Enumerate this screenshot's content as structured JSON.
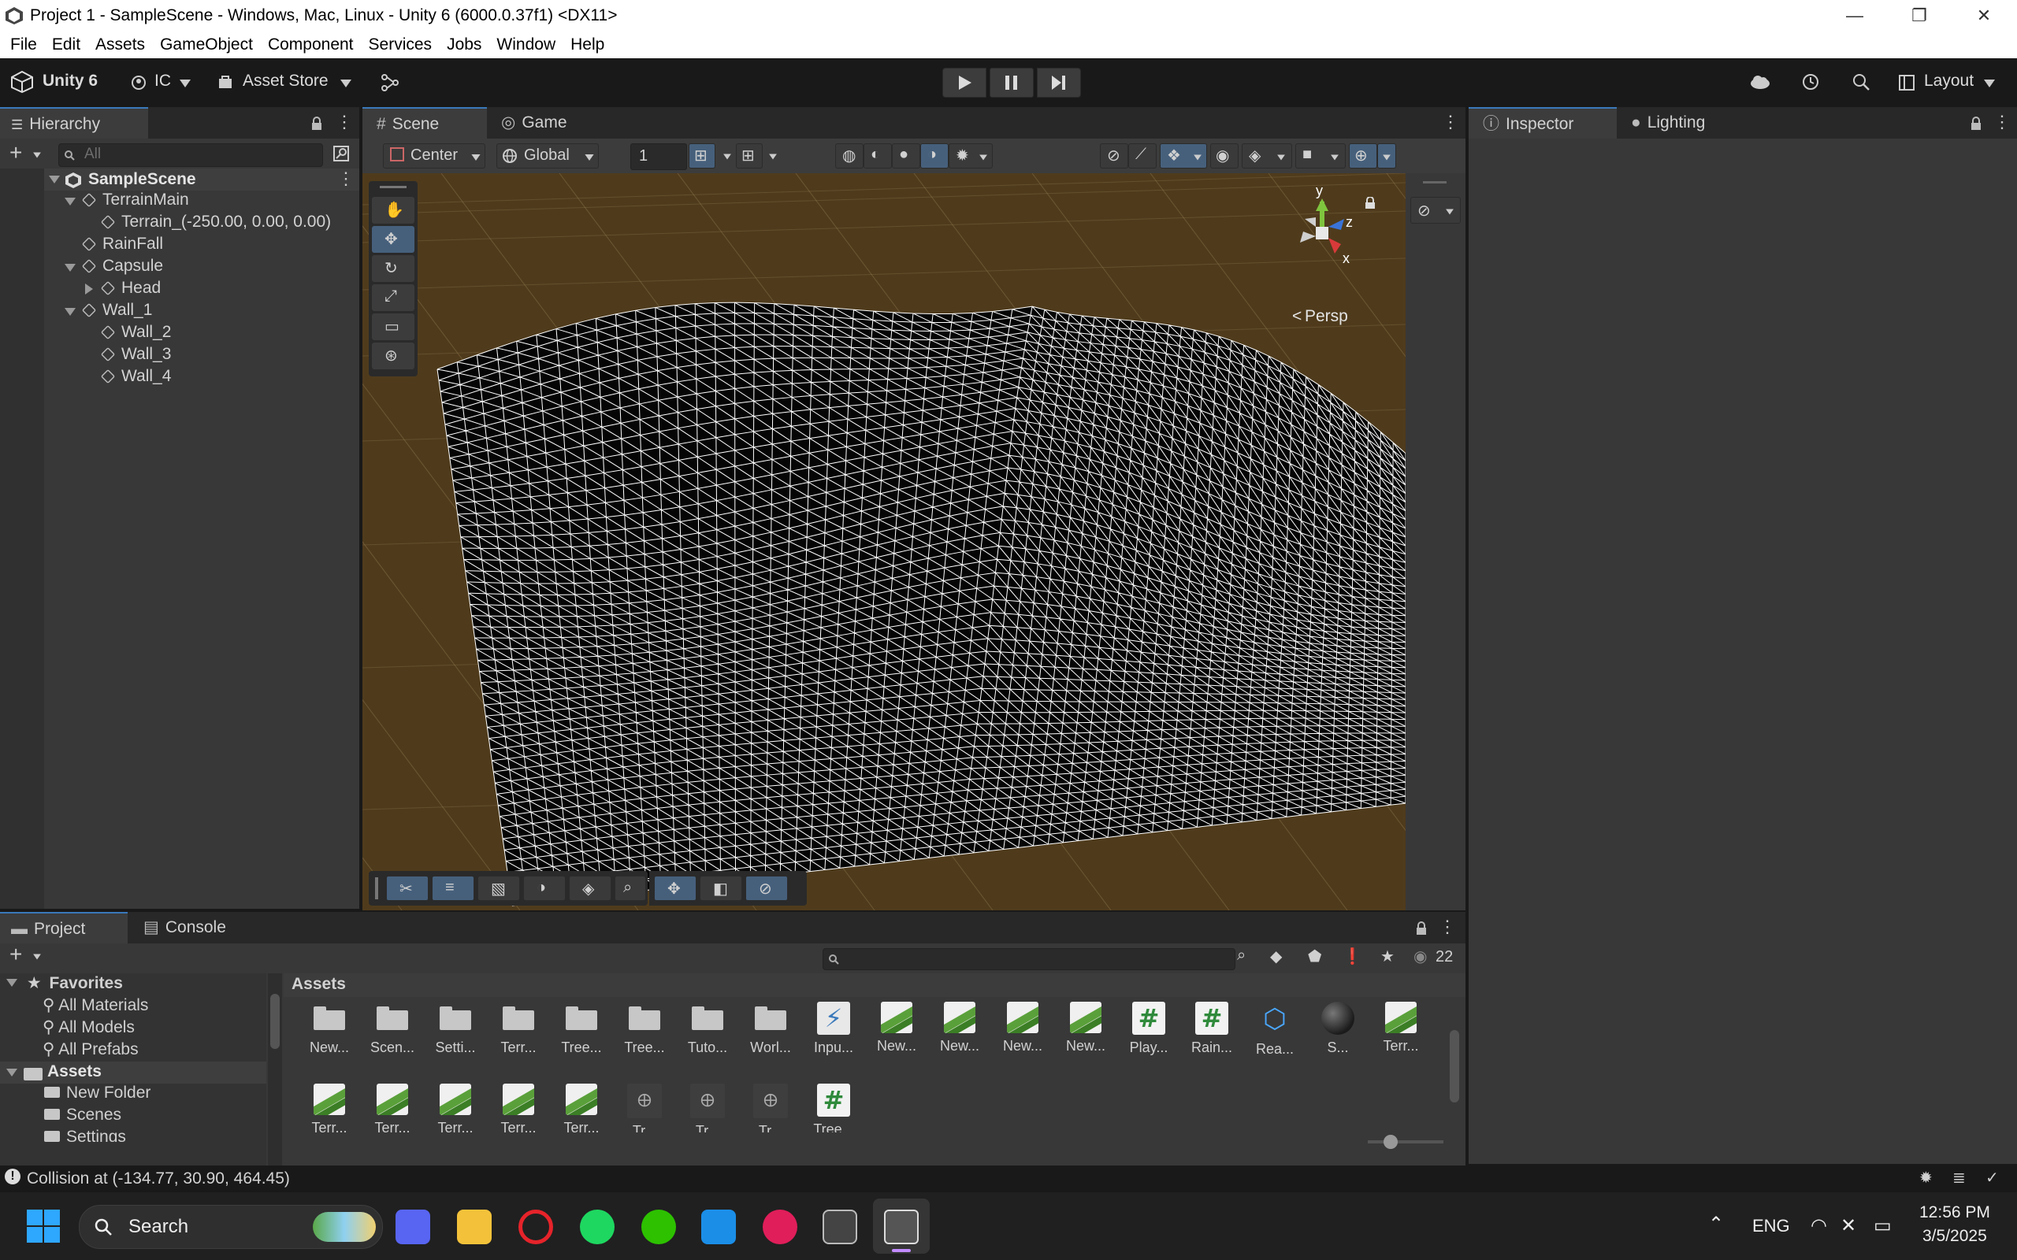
{
  "window": {
    "title": "Project 1 - SampleScene - Windows, Mac, Linux - Unity 6 (6000.0.37f1) <DX11>",
    "minimize": "—",
    "maximize": "❐",
    "close": "✕"
  },
  "menu": [
    "File",
    "Edit",
    "Assets",
    "GameObject",
    "Component",
    "Services",
    "Jobs",
    "Window",
    "Help"
  ],
  "toolbar": {
    "brand": "Unity 6",
    "account": "IC",
    "asset_store": "Asset Store",
    "layout": "Layout"
  },
  "hierarchy": {
    "tab": "Hierarchy",
    "search_placeholder": "All",
    "scene": "SampleScene",
    "items": [
      {
        "label": "TerrainMain"
      },
      {
        "label": "Terrain_(-250.00, 0.00, 0.00)"
      },
      {
        "label": "RainFall"
      },
      {
        "label": "Capsule"
      },
      {
        "label": "Head"
      },
      {
        "label": "Wall_1"
      },
      {
        "label": "Wall_2"
      },
      {
        "label": "Wall_3"
      },
      {
        "label": "Wall_4"
      }
    ]
  },
  "scene_view": {
    "tabs": [
      "Scene",
      "Game"
    ],
    "pivot": "Center",
    "space": "Global",
    "grid_value": "1",
    "gizmo_labels": {
      "y": "y",
      "z": "z",
      "x": "x"
    },
    "projection": "Persp"
  },
  "inspector": {
    "tabs": [
      "Inspector",
      "Lighting"
    ]
  },
  "project": {
    "tabs": [
      "Project",
      "Console"
    ],
    "hidden_count": "22",
    "breadcrumb": "Assets",
    "favorites_title": "Favorites",
    "favorites": [
      "All Materials",
      "All Models",
      "All Prefabs"
    ],
    "tree_root": "Assets",
    "tree_items": [
      "New Folder",
      "Scenes",
      "Settings"
    ],
    "assets_row1": [
      "New...",
      "Scen...",
      "Setti...",
      "Terr...",
      "Tree...",
      "Tree...",
      "Tuto...",
      "Worl...",
      "Inpu...",
      "New...",
      "New...",
      "New...",
      "New...",
      "Play...",
      "Rain...",
      "Rea...",
      "S...",
      "Terr..."
    ],
    "assets_row2": [
      "Terr...",
      "Terr...",
      "Terr...",
      "Terr...",
      "Terr...",
      "Tr...",
      "Tr...",
      "Tr...",
      "Tree..."
    ]
  },
  "status": {
    "message": "Collision at (-134.77, 30.90, 464.45)"
  },
  "taskbar": {
    "search": "Search",
    "language": "ENG",
    "time": "12:56 PM",
    "date": "3/5/2025"
  },
  "colors": {
    "accent": "#3a79bb",
    "scene_bg": "#4f3b1c",
    "wire": "#ffffff"
  }
}
